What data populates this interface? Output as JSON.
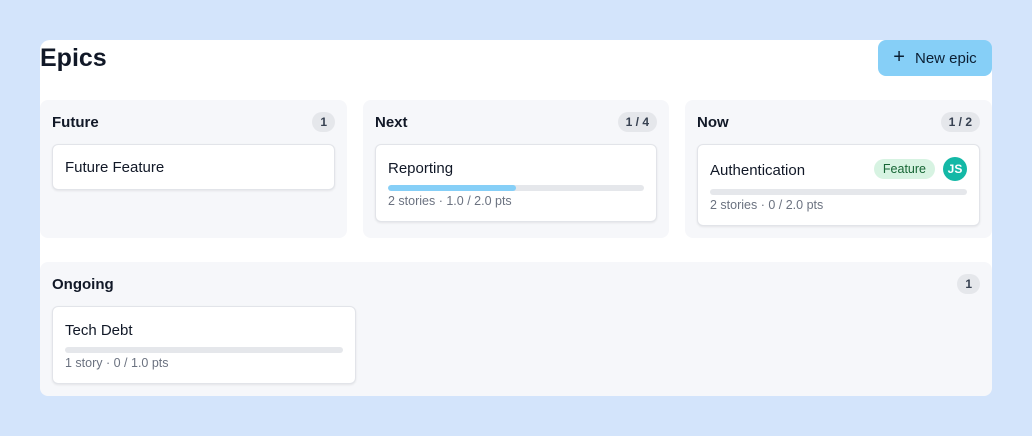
{
  "header": {
    "title": "Epics",
    "new_epic_label": "New epic"
  },
  "colors": {
    "accent": "#86cff7",
    "avatar": "#14b8a6",
    "tag_bg": "#d7f3e2",
    "tag_text": "#166534"
  },
  "columns": {
    "future": {
      "title": "Future",
      "count": "1",
      "cards": [
        {
          "title": "Future Feature"
        }
      ]
    },
    "next": {
      "title": "Next",
      "count": "1 / 4",
      "cards": [
        {
          "title": "Reporting",
          "progress": 0.5,
          "meta": "2 stories · 1.0 / 2.0 pts"
        }
      ]
    },
    "now": {
      "title": "Now",
      "count": "1 / 2",
      "cards": [
        {
          "title": "Authentication",
          "tag": "Feature",
          "avatar": "JS",
          "progress": 0,
          "meta": "2 stories · 0 / 2.0 pts"
        }
      ]
    },
    "ongoing": {
      "title": "Ongoing",
      "count": "1",
      "cards": [
        {
          "title": "Tech Debt",
          "progress": 0,
          "meta": "1 story · 0 / 1.0 pts"
        }
      ]
    }
  }
}
